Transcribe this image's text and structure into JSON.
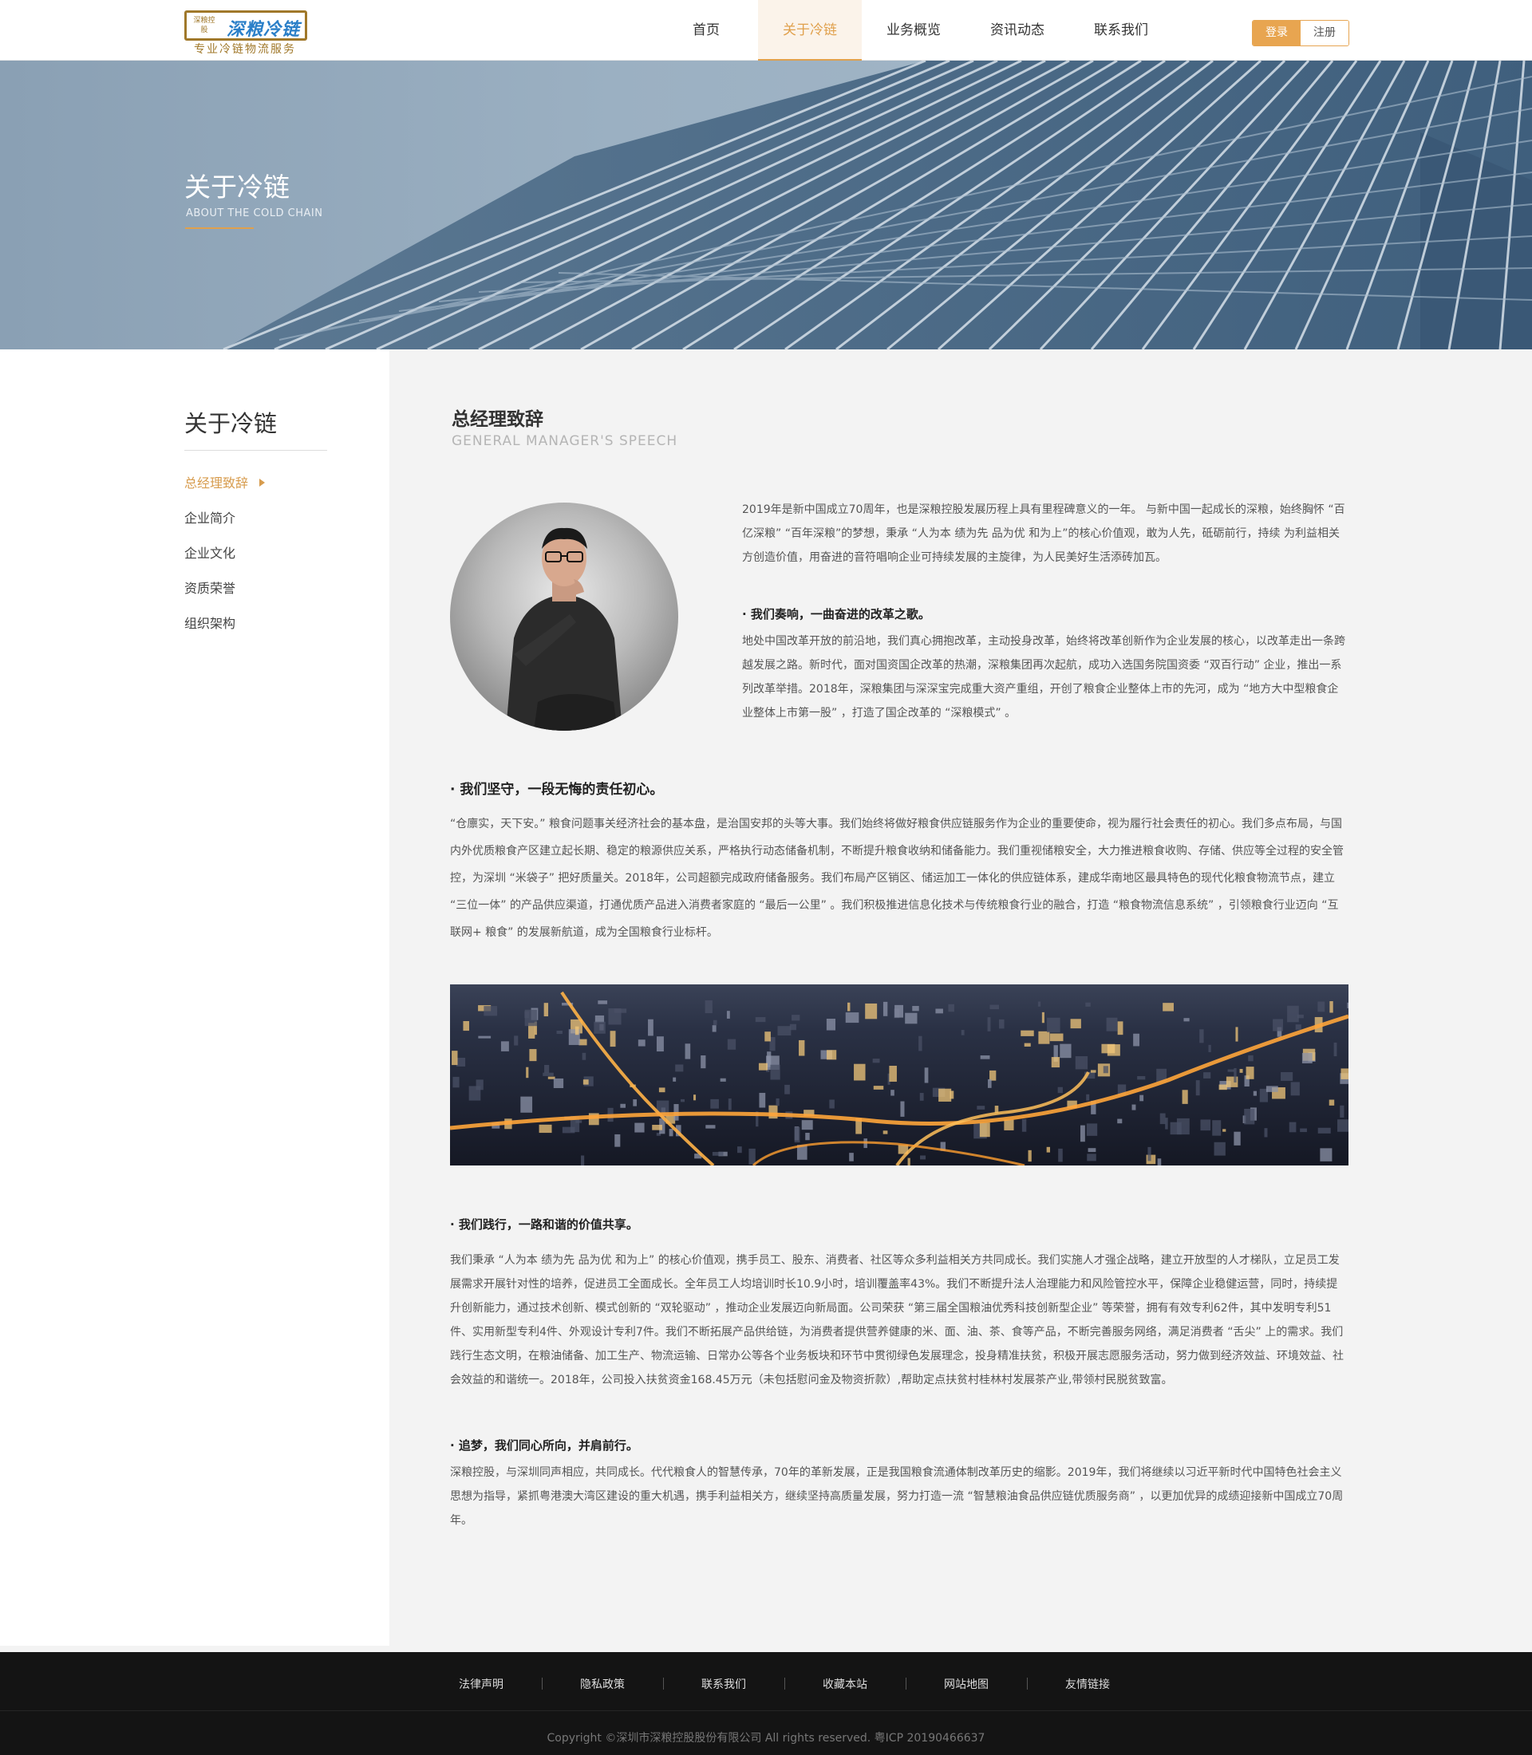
{
  "header": {
    "logo": {
      "emblem_text": "深粮控股",
      "title": "深粮冷链",
      "subtitle": "专业冷链物流服务"
    },
    "nav": [
      {
        "label": "首页",
        "active": false
      },
      {
        "label": "关于冷链",
        "active": true
      },
      {
        "label": "业务概览",
        "active": false
      },
      {
        "label": "资讯动态",
        "active": false
      },
      {
        "label": "联系我们",
        "active": false
      }
    ],
    "login_label": "登录",
    "register_label": "注册"
  },
  "banner": {
    "title": "关于冷链",
    "subtitle": "ABOUT THE COLD CHAIN"
  },
  "sidebar": {
    "title": "关于冷链",
    "items": [
      {
        "label": "总经理致辞",
        "active": true
      },
      {
        "label": "企业简介",
        "active": false
      },
      {
        "label": "企业文化",
        "active": false
      },
      {
        "label": "资质荣誉",
        "active": false
      },
      {
        "label": "组织架构",
        "active": false
      }
    ]
  },
  "main": {
    "title": "总经理致辞",
    "subtitle": "GENERAL MANAGER'S SPEECH",
    "intro": "2019年是新中国成立70周年，也是深粮控股发展历程上具有里程碑意义的一年。 与新中国一起成长的深粮，始终胸怀 “百亿深粮” “百年深粮”的梦想，秉承 “人为本 绩为先 品为优 和为上”的核心价值观，敢为人先，砥砺前行，持续 为利益相关方创造价值，用奋进的音符唱响企业可持续发展的主旋律，为人民美好生活添砖加瓦。",
    "s1_head": "·  我们奏响，一曲奋进的改革之歌。",
    "s1_body": "地处中国改革开放的前沿地，我们真心拥抱改革，主动投身改革，始终将改革创新作为企业发展的核心，以改革走出一条跨越发展之路。新时代，面对国资国企改革的热潮，深粮集团再次起航，成功入选国务院国资委 “双百行动” 企业，推出一系列改革举措。2018年，深粮集团与深深宝完成重大资产重组，开创了粮食企业整体上市的先河，成为 “地方大中型粮食企业整体上市第一股” ，打造了国企改革的 “深粮模式” 。",
    "s2_head": "·  我们坚守，一段无悔的责任初心。",
    "s2_body": "“仓廪实，天下安。” 粮食问题事关经济社会的基本盘，是治国安邦的头等大事。我们始终将做好粮食供应链服务作为企业的重要使命，视为履行社会责任的初心。我们多点布局，与国内外优质粮食产区建立起长期、稳定的粮源供应关系，严格执行动态储备机制，不断提升粮食收纳和储备能力。我们重视储粮安全，大力推进粮食收购、存储、供应等全过程的安全管控，为深圳 “米袋子” 把好质量关。2018年，公司超额完成政府储备服务。我们布局产区销区、储运加工一体化的供应链体系，建成华南地区最具特色的现代化粮食物流节点，建立 “三位一体” 的产品供应渠道，打通优质产品进入消费者家庭的 “最后一公里” 。我们积极推进信息化技术与传统粮食行业的融合，打造 “粮食物流信息系统” ，引领粮食行业迈向 “互联网+ 粮食” 的发展新航道，成为全国粮食行业标杆。",
    "s3_head": "·  我们践行，一路和谐的价值共享。",
    "s3_body": "我们秉承 “人为本 绩为先 品为优 和为上” 的核心价值观，携手员工、股东、消费者、社区等众多利益相关方共同成长。我们实施人才强企战略，建立开放型的人才梯队，立足员工发展需求开展针对性的培养，促进员工全面成长。全年员工人均培训时长10.9小时，培训覆盖率43%。我们不断提升法人治理能力和风险管控水平，保障企业稳健运营，同时，持续提升创新能力，通过技术创新、模式创新的 “双轮驱动” ，推动企业发展迈向新局面。公司荣获 “第三届全国粮油优秀科技创新型企业” 等荣誉，拥有有效专利62件，其中发明专利51件、实用新型专利4件、外观设计专利7件。我们不断拓展产品供给链，为消费者提供营养健康的米、面、油、茶、食等产品，不断完善服务网络，满足消费者 “舌尖” 上的需求。我们践行生态文明，在粮油储备、加工生产、物流运输、日常办公等各个业务板块和环节中贯彻绿色发展理念，投身精准扶贫，积极开展志愿服务活动，努力做到经济效益、环境效益、社会效益的和谐统一。2018年，公司投入扶贫资金168.45万元（未包括慰问金及物资折款）,帮助定点扶贫村桂林村发展茶产业,带领村民脱贫致富。",
    "s4_head": "·  追梦，我们同心所向，并肩前行。",
    "s4_body": "深粮控股，与深圳同声相应，共同成长。代代粮食人的智慧传承，70年的革新发展，正是我国粮食流通体制改革历史的缩影。2019年，我们将继续以习近平新时代中国特色社会主义思想为指导，紧抓粤港澳大湾区建设的重大机遇，携手利益相关方，继续坚持高质量发展，努力打造一流 “智慧粮油食品供应链优质服务商” ，以更加优异的成绩迎接新中国成立70周年。"
  },
  "footer": {
    "links": [
      "法律声明",
      "隐私政策",
      "联系我们",
      "收藏本站",
      "网站地图",
      "友情链接"
    ],
    "copyright": "Copyright  ©深圳市深粮控股股份有限公司  All  rights  reserved.   粤ICP  20190466637"
  },
  "colors": {
    "accent": "#e0a04c",
    "footer_bg": "#141414",
    "logo_blue": "#2a7fc8",
    "logo_gold": "#a0782a"
  }
}
